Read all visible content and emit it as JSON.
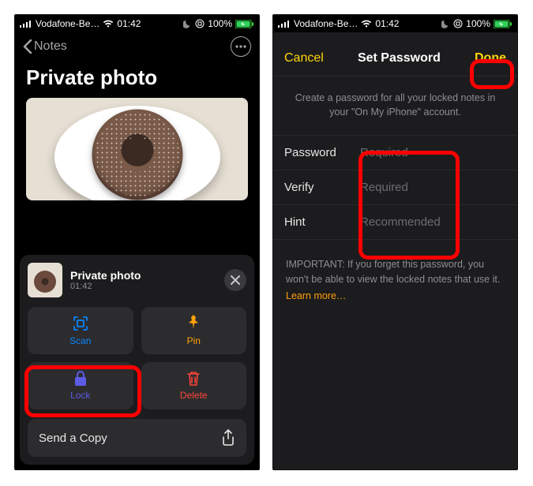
{
  "status": {
    "carrier": "Vodafone-Be…",
    "time": "01:42",
    "battery": "100%"
  },
  "left": {
    "back": "Notes",
    "title": "Private photo",
    "sheet": {
      "title": "Private photo",
      "subtitle": "01:42",
      "actions": {
        "scan": "Scan",
        "pin": "Pin",
        "lock": "Lock",
        "delete": "Delete"
      },
      "send": "Send a Copy"
    }
  },
  "right": {
    "cancel": "Cancel",
    "title": "Set Password",
    "done": "Done",
    "desc": "Create a password for all your locked notes in your \"On My iPhone\" account.",
    "rows": {
      "password": {
        "label": "Password",
        "placeholder": "Required"
      },
      "verify": {
        "label": "Verify",
        "placeholder": "Required"
      },
      "hint": {
        "label": "Hint",
        "placeholder": "Recommended"
      }
    },
    "important": "IMPORTANT: If you forget this password, you won't be able to view the locked notes that use it.",
    "learn": "Learn more…"
  }
}
